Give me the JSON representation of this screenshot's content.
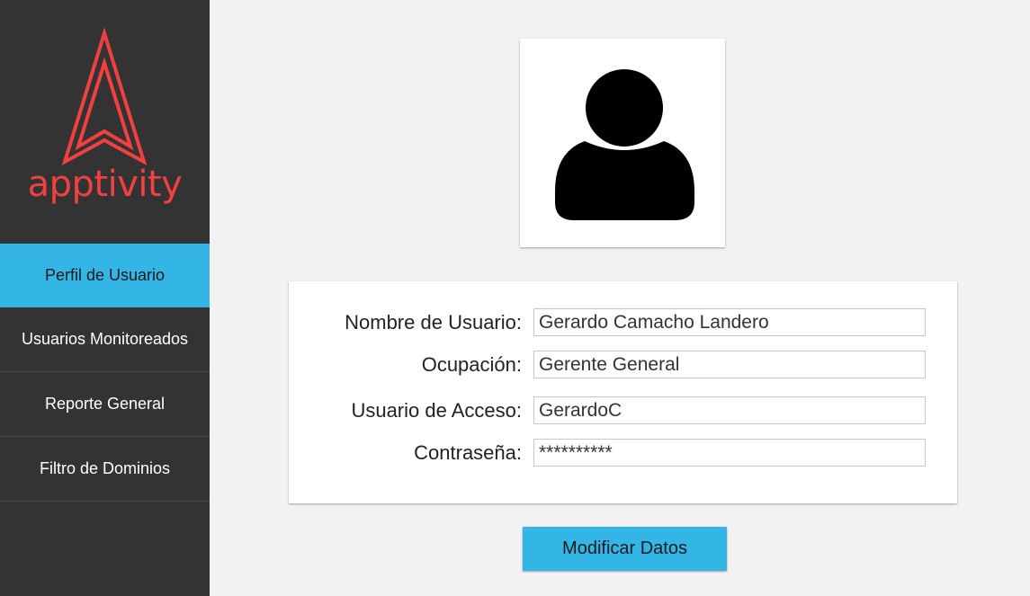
{
  "brand": {
    "name": "apptivity",
    "color": "#f04040"
  },
  "sidebar": {
    "items": [
      {
        "label": "Perfil de Usuario",
        "active": true
      },
      {
        "label": "Usuarios Monitoreados",
        "active": false
      },
      {
        "label": "Reporte General",
        "active": false
      },
      {
        "label": "Filtro de Dominios",
        "active": false
      }
    ]
  },
  "profile": {
    "avatar_icon": "user-silhouette-icon",
    "fields": [
      {
        "label": "Nombre de Usuario:",
        "value": "Gerardo Camacho Landero"
      },
      {
        "label": "Ocupación:",
        "value": "Gerente General"
      },
      {
        "label": "Usuario de Acceso:",
        "value": "GerardoC"
      },
      {
        "label": "Contraseña:",
        "value": "**********"
      }
    ]
  },
  "actions": {
    "modify_label": "Modificar Datos"
  },
  "colors": {
    "accent": "#33b5e5",
    "sidebar_bg": "#333333"
  }
}
